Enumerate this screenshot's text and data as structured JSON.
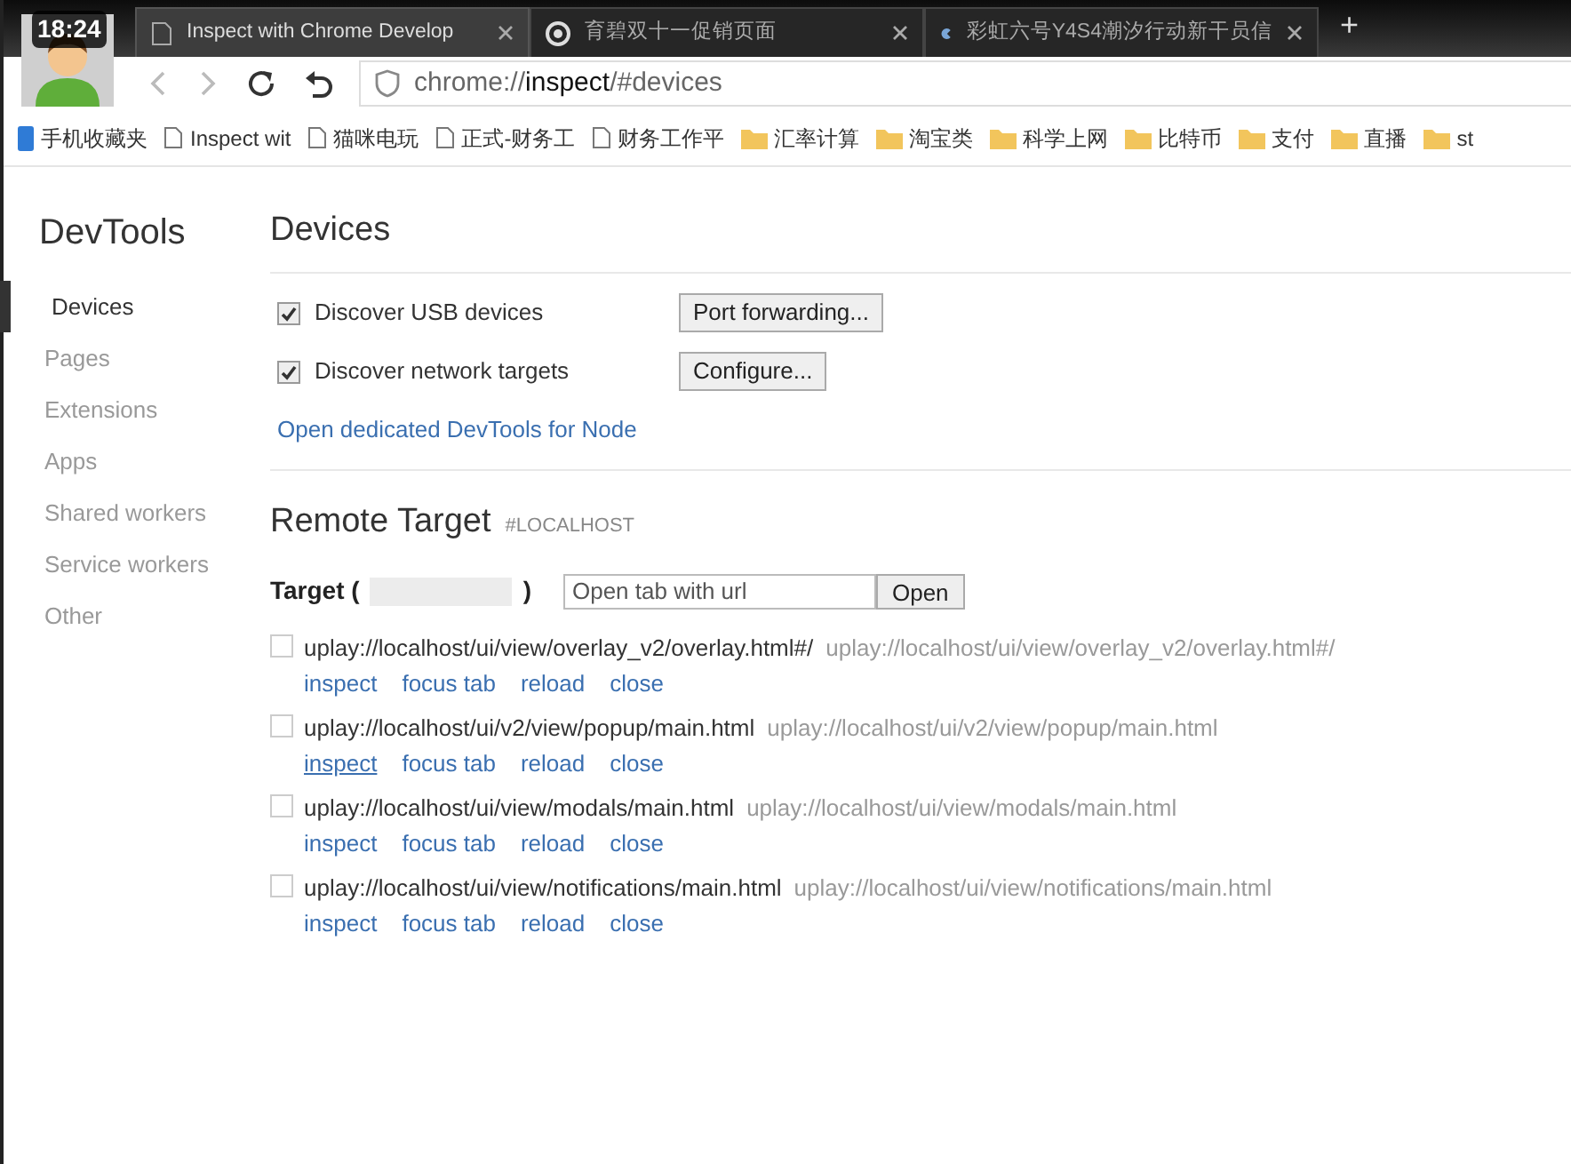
{
  "clock": "18:24",
  "tabs": [
    {
      "title": "Inspect with Chrome Develop",
      "selected": true,
      "kind": "page"
    },
    {
      "title": "育碧双十一促销页面",
      "selected": false,
      "kind": "swirl"
    },
    {
      "title": "彩虹六号Y4S4潮汐行动新干员信",
      "selected": false,
      "kind": "logo"
    }
  ],
  "new_tab": "+",
  "address": {
    "scheme": "chrome://",
    "host": "inspect",
    "path": "/#devices"
  },
  "bookmarks": [
    {
      "label": "手机收藏夹",
      "kind": "mobile"
    },
    {
      "label": "Inspect wit",
      "kind": "page"
    },
    {
      "label": "猫咪电玩",
      "kind": "page"
    },
    {
      "label": "正式-财务工",
      "kind": "page"
    },
    {
      "label": "财务工作平",
      "kind": "page"
    },
    {
      "label": "汇率计算",
      "kind": "folder"
    },
    {
      "label": "淘宝类",
      "kind": "folder"
    },
    {
      "label": "科学上网",
      "kind": "folder"
    },
    {
      "label": "比特币",
      "kind": "folder"
    },
    {
      "label": "支付",
      "kind": "folder"
    },
    {
      "label": "直播",
      "kind": "folder"
    },
    {
      "label": "st",
      "kind": "folder"
    }
  ],
  "sidebar": {
    "title": "DevTools",
    "items": [
      {
        "label": "Devices",
        "selected": true
      },
      {
        "label": "Pages",
        "selected": false
      },
      {
        "label": "Extensions",
        "selected": false
      },
      {
        "label": "Apps",
        "selected": false
      },
      {
        "label": "Shared workers",
        "selected": false
      },
      {
        "label": "Service workers",
        "selected": false
      },
      {
        "label": "Other",
        "selected": false
      }
    ]
  },
  "devices": {
    "heading": "Devices",
    "options": [
      {
        "label": "Discover USB devices",
        "checked": true,
        "button": "Port forwarding..."
      },
      {
        "label": "Discover network targets",
        "checked": true,
        "button": "Configure..."
      }
    ],
    "node_link": "Open dedicated DevTools for Node"
  },
  "remote": {
    "heading": "Remote Target",
    "tag": "#LOCALHOST",
    "target_open": "Target (",
    "target_close": ")",
    "url_placeholder": "Open tab with url",
    "open_button": "Open",
    "targets": [
      {
        "name": "uplay://localhost/ui/view/overlay_v2/overlay.html#/",
        "url": "uplay://localhost/ui/view/overlay_v2/overlay.html#/",
        "checked": false,
        "actions": [
          {
            "label": "inspect",
            "hovered": false
          },
          {
            "label": "focus tab",
            "hovered": false
          },
          {
            "label": "reload",
            "hovered": false
          },
          {
            "label": "close",
            "hovered": false
          }
        ]
      },
      {
        "name": "uplay://localhost/ui/v2/view/popup/main.html",
        "url": "uplay://localhost/ui/v2/view/popup/main.html",
        "checked": false,
        "actions": [
          {
            "label": "inspect",
            "hovered": true
          },
          {
            "label": "focus tab",
            "hovered": false
          },
          {
            "label": "reload",
            "hovered": false
          },
          {
            "label": "close",
            "hovered": false
          }
        ]
      },
      {
        "name": "uplay://localhost/ui/view/modals/main.html",
        "url": "uplay://localhost/ui/view/modals/main.html",
        "checked": false,
        "actions": [
          {
            "label": "inspect",
            "hovered": false
          },
          {
            "label": "focus tab",
            "hovered": false
          },
          {
            "label": "reload",
            "hovered": false
          },
          {
            "label": "close",
            "hovered": false
          }
        ]
      },
      {
        "name": "uplay://localhost/ui/view/notifications/main.html",
        "url": "uplay://localhost/ui/view/notifications/main.html",
        "checked": false,
        "actions": [
          {
            "label": "inspect",
            "hovered": false
          },
          {
            "label": "focus tab",
            "hovered": false
          },
          {
            "label": "reload",
            "hovered": false
          },
          {
            "label": "close",
            "hovered": false
          }
        ]
      }
    ]
  }
}
